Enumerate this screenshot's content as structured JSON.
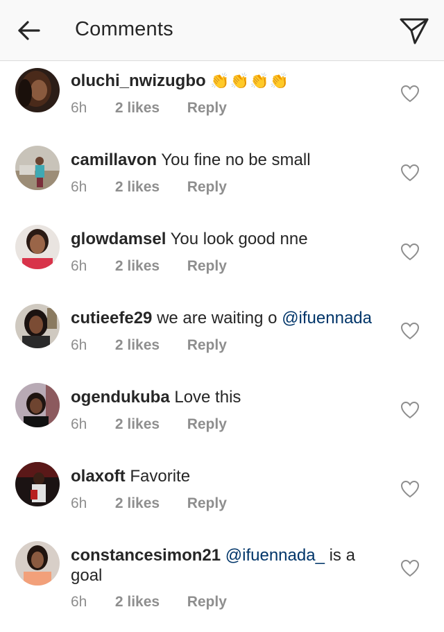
{
  "header": {
    "title": "Comments",
    "back_icon": "arrow-left-icon",
    "send_icon": "paper-plane-icon"
  },
  "colors": {
    "text": "#262626",
    "secondary": "#8e8e8e",
    "mention": "#003569",
    "header_bg": "#f9f9f9"
  },
  "comments": [
    {
      "username": "oluchi_nwizugbo",
      "text": "",
      "emoji": "👏👏👏👏",
      "time": "6h",
      "likes": "2 likes",
      "reply": "Reply"
    },
    {
      "username": "camillavon",
      "text": "You fine no be small",
      "time": "6h",
      "likes": "2 likes",
      "reply": "Reply"
    },
    {
      "username": "glowdamsel",
      "text": "You look good nne",
      "time": "6h",
      "likes": "2 likes",
      "reply": "Reply"
    },
    {
      "username": "cutieefe29",
      "text": "we are waiting o",
      "mention": "@ifuennada",
      "time": "6h",
      "likes": "2 likes",
      "reply": "Reply"
    },
    {
      "username": "ogendukuba",
      "text": "Love this",
      "time": "6h",
      "likes": "2 likes",
      "reply": "Reply"
    },
    {
      "username": "olaxoft",
      "text": "Favorite",
      "time": "6h",
      "likes": "2 likes",
      "reply": "Reply"
    },
    {
      "username": "constancesimon21",
      "mention": "@ifuennada_",
      "text": " is a goal",
      "time": "6h",
      "likes": "2 likes",
      "reply": "Reply"
    }
  ]
}
